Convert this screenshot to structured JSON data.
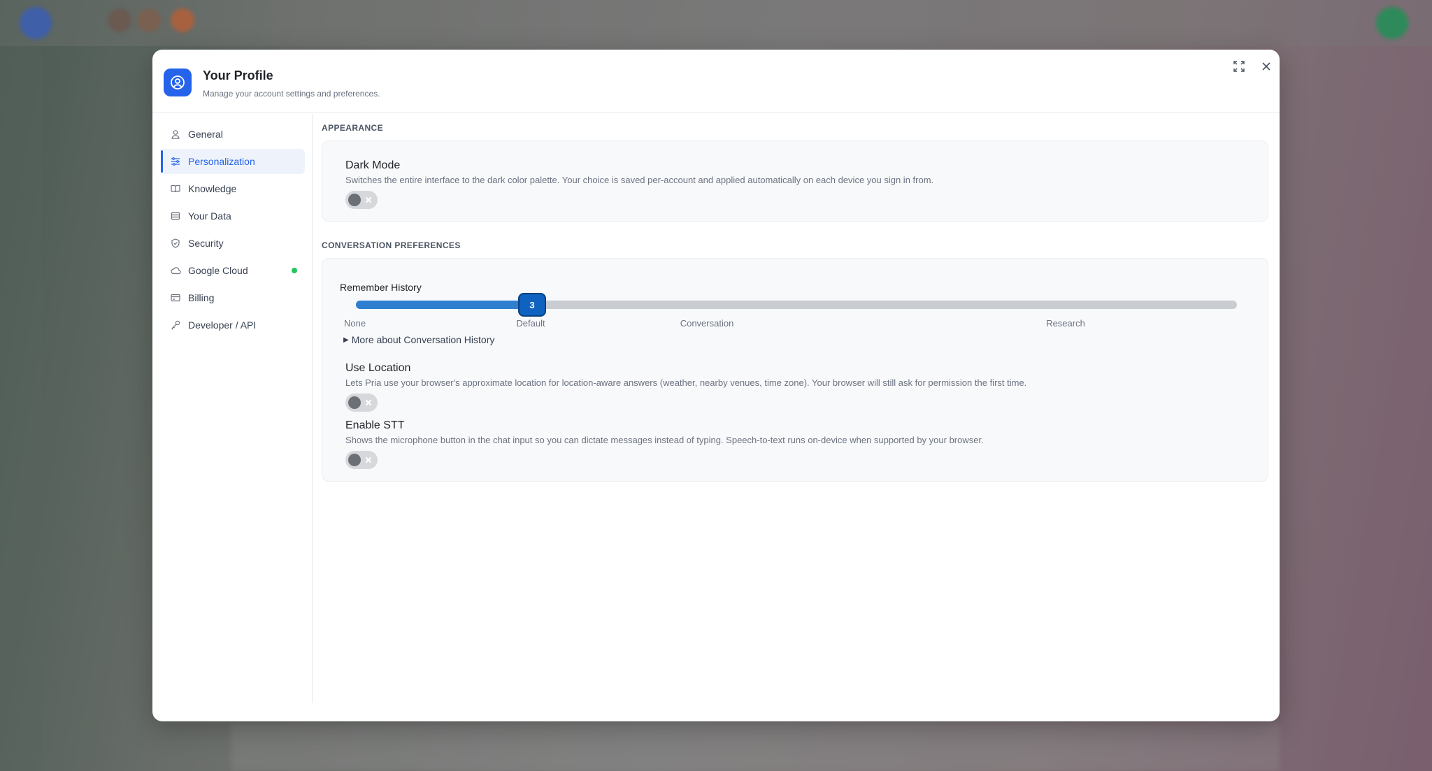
{
  "modal": {
    "title": "Your Profile",
    "subtitle": "Manage your account settings and preferences."
  },
  "sidebar": {
    "items": [
      {
        "label": "General",
        "icon": "user-icon"
      },
      {
        "label": "Personalization",
        "icon": "sliders-icon",
        "active": true
      },
      {
        "label": "Knowledge",
        "icon": "book-icon"
      },
      {
        "label": "Your Data",
        "icon": "database-icon"
      },
      {
        "label": "Security",
        "icon": "shield-icon"
      },
      {
        "label": "Google Cloud",
        "icon": "cloud-icon",
        "status": "connected"
      },
      {
        "label": "Billing",
        "icon": "credit-card-icon"
      },
      {
        "label": "Developer / API",
        "icon": "key-icon"
      }
    ]
  },
  "appearance": {
    "section_label": "APPEARANCE",
    "dark_mode": {
      "title": "Dark Mode",
      "description": "Switches the entire interface to the dark color palette. Your choice is saved per-account and applied automatically on each device you sign in from.",
      "enabled": false
    }
  },
  "conversation": {
    "section_label": "CONVERSATION PREFERENCES",
    "remember_history": {
      "title": "Remember History",
      "value": "3",
      "fill_fraction": 0.2,
      "ticks": [
        "None",
        "Default",
        "Conversation",
        "Research"
      ],
      "more_link": "More about Conversation History"
    },
    "use_location": {
      "title": "Use Location",
      "description": "Lets Pria use your browser's approximate location for location-aware answers (weather, nearby venues, time zone). Your browser will still ask for permission the first time.",
      "enabled": false
    },
    "enable_stt": {
      "title": "Enable STT",
      "description": "Shows the microphone button in the chat input so you can dictate messages instead of typing. Speech-to-text runs on-device when supported by your browser.",
      "enabled": false
    }
  },
  "colors": {
    "accent": "#2563eb",
    "slider_fill": "#2f7fd1",
    "status_green": "#22c55e"
  }
}
